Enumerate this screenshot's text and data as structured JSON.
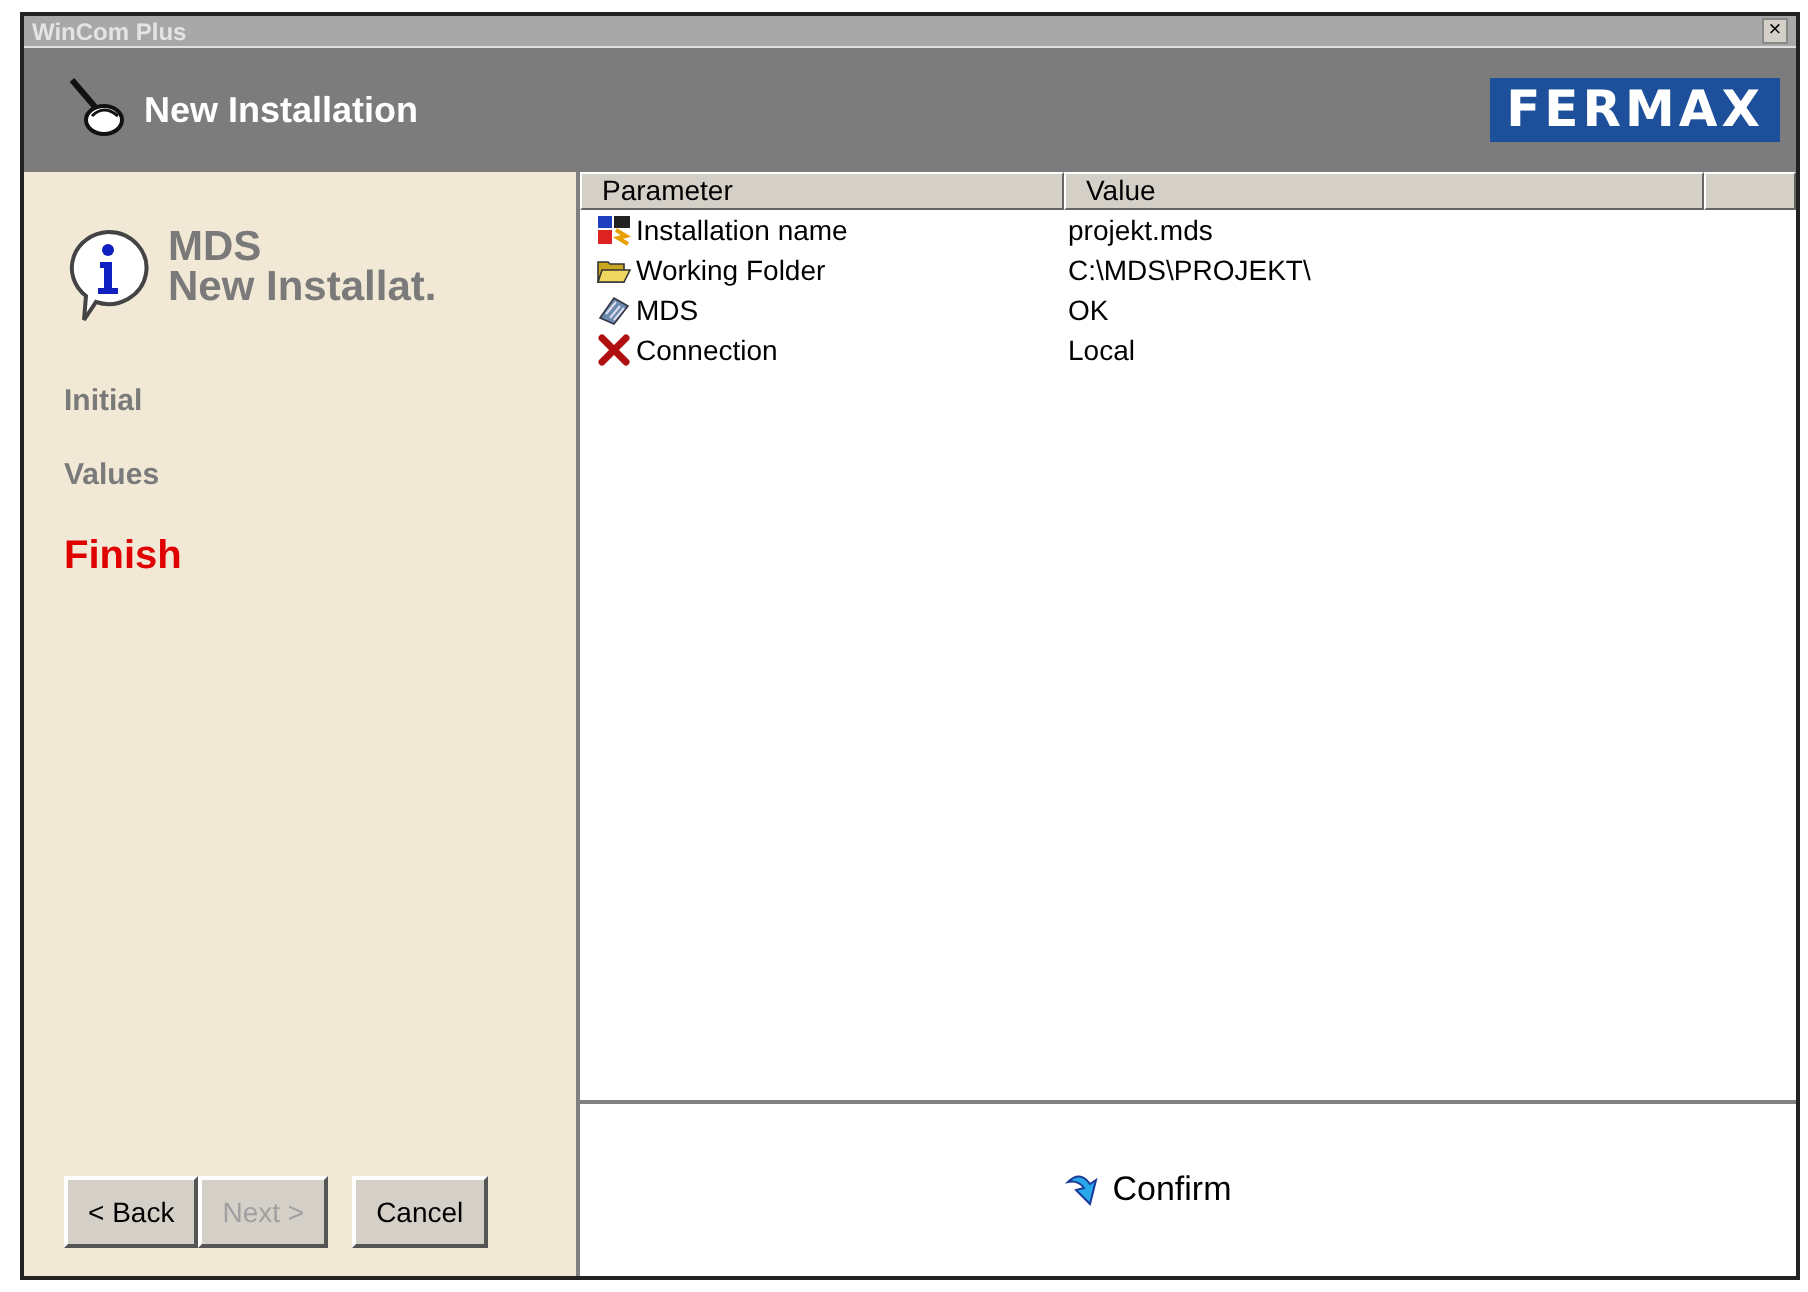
{
  "window": {
    "title": "WinCom Plus",
    "close": "×"
  },
  "header": {
    "title": "New Installation",
    "logo": "FERMAX"
  },
  "sidebar": {
    "heading_line_1": "MDS",
    "heading_line_2": "New Installat.",
    "steps": [
      {
        "label": "Initial",
        "selected": false
      },
      {
        "label": "Values",
        "selected": false
      },
      {
        "label": "Finish",
        "selected": true
      }
    ],
    "buttons": [
      {
        "label": "< Back",
        "disabled": false
      },
      {
        "label": "Next >",
        "disabled": true
      },
      {
        "label": "Cancel",
        "disabled": false
      }
    ]
  },
  "table": {
    "columns": [
      "Parameter",
      "Value"
    ],
    "rows": [
      {
        "kind": "installation",
        "parameter": "Installation name",
        "value": "projekt.mds"
      },
      {
        "kind": "folder",
        "parameter": "Working Folder",
        "value": "C:\\MDS\\PROJEKT\\"
      },
      {
        "kind": "device",
        "parameter": "MDS",
        "value": "OK"
      },
      {
        "kind": "error",
        "parameter": "Connection",
        "value": "Local"
      }
    ]
  },
  "confirm": "Confirm"
}
